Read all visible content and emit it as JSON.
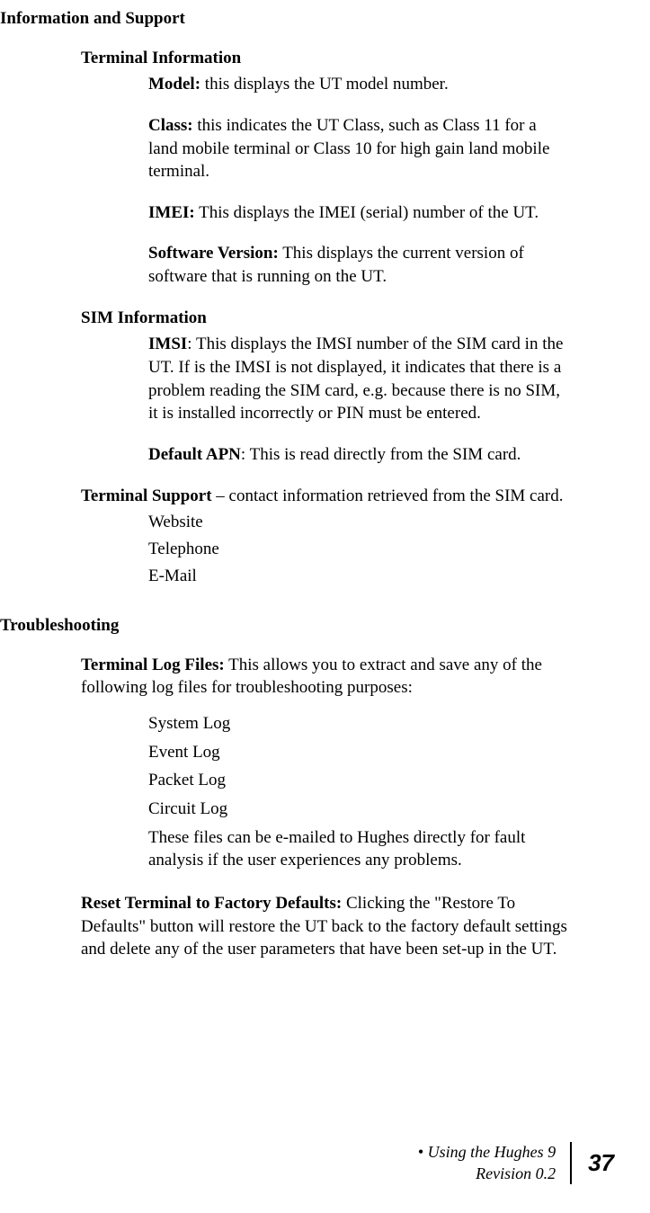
{
  "heading_main": "Information and Support",
  "terminal_info": {
    "heading": "Terminal Information",
    "model_label": "Model:",
    "model_text": " this displays the UT model number.",
    "class_label": "Class:",
    "class_text": " this indicates the UT Class, such as Class 11 for a land mobile terminal or Class 10 for high gain land mobile terminal.",
    "imei_label": "IMEI:",
    "imei_text": "  This displays the IMEI (serial) number of the UT.",
    "sw_label": "Software Version:",
    "sw_text": "  This displays the current version of software that is running on the UT."
  },
  "sim_info": {
    "heading": "SIM Information",
    "imsi_label": "IMSI",
    "imsi_text": ":  This displays the IMSI number of the SIM card in the UT. If is the IMSI is not displayed, it indicates that there is a problem reading the SIM card, e.g. because there is no SIM, it is installed incorrectly or PIN must be entered.",
    "apn_label": "Default APN",
    "apn_text": ": This is read directly from the SIM card."
  },
  "terminal_support": {
    "heading_bold": "Terminal Support",
    "heading_rest": " – contact information retrieved from the SIM card.",
    "items": [
      "Website",
      "Telephone",
      "E-Mail"
    ]
  },
  "troubleshooting": {
    "heading": "Troubleshooting",
    "logfiles_label": "Terminal Log Files:",
    "logfiles_text": " This allows you to extract and save any of the following log files for troubleshooting purposes:",
    "logs": [
      "System Log",
      "Event Log",
      "Packet Log",
      "Circuit Log"
    ],
    "logs_note": "These files can be e-mailed to Hughes directly for fault analysis if the user experiences any problems.",
    "reset_label": "Reset Terminal to Factory Defaults:",
    "reset_text": "  Clicking the \"Restore To Defaults\" button will restore the UT back to the factory default settings and delete any of the user parameters that have been set-up in the UT."
  },
  "footer": {
    "line1": "• Using the Hughes 9",
    "line2": "Revision 0.2",
    "page": "37"
  }
}
